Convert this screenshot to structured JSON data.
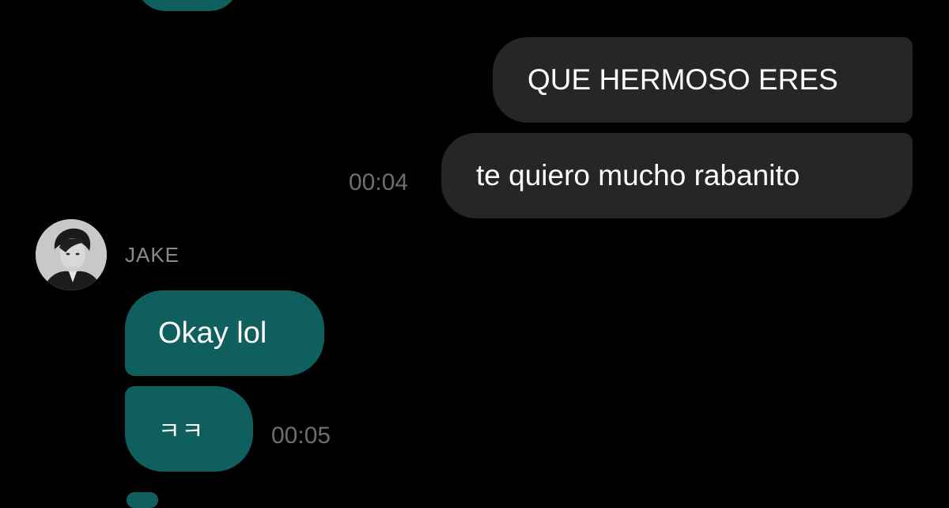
{
  "messages": {
    "outgoing": [
      {
        "text": "QUE HERMOSO ERES"
      },
      {
        "text": "te quiero mucho rabanito",
        "time": "00:04"
      }
    ],
    "incoming": {
      "sender": "JAKE",
      "bubbles": [
        {
          "text": "Okay lol"
        },
        {
          "text": "ㅋㅋ",
          "time": "00:05"
        }
      ]
    }
  },
  "colors": {
    "background": "#000000",
    "outgoing_bubble": "#262626",
    "incoming_bubble": "#0f5f5f",
    "timestamp": "#6e6e6e",
    "sender_name": "#8a8a8a"
  }
}
